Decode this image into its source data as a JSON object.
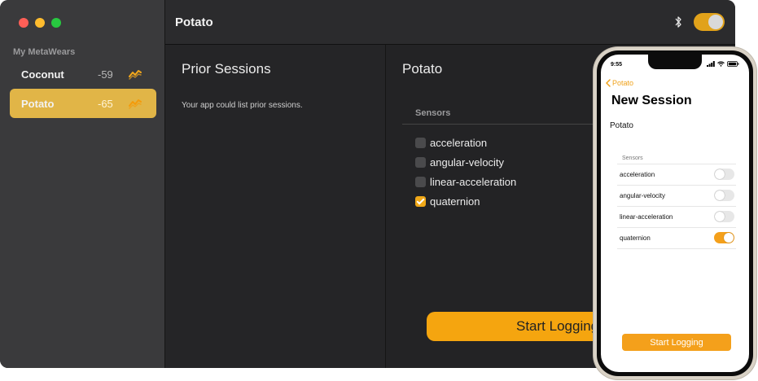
{
  "mac": {
    "sidebar": {
      "section_title": "My MetaWears",
      "devices": [
        {
          "name": "Coconut",
          "rssi": "-59",
          "selected": false
        },
        {
          "name": "Potato",
          "rssi": "-65",
          "selected": true
        }
      ]
    },
    "toolbar": {
      "title": "Potato",
      "bluetooth_enabled": true
    },
    "prior_sessions": {
      "title": "Prior Sessions",
      "description": "Your app could list prior sessions."
    },
    "detail": {
      "title": "Potato",
      "sensors_header": "Sensors",
      "sensors": [
        {
          "name": "acceleration",
          "checked": false
        },
        {
          "name": "angular-velocity",
          "checked": false
        },
        {
          "name": "linear-acceleration",
          "checked": false
        },
        {
          "name": "quaternion",
          "checked": true
        }
      ],
      "start_button": "Start Logging"
    },
    "colors": {
      "accent": "#f5a50f",
      "selected_row": "#e1b547"
    }
  },
  "phone": {
    "status_time": "9:55",
    "back_label": "Potato",
    "title": "New Session",
    "device_name": "Potato",
    "sensors_header": "Sensors",
    "sensors": [
      {
        "name": "acceleration",
        "on": false
      },
      {
        "name": "angular-velocity",
        "on": false
      },
      {
        "name": "linear-acceleration",
        "on": false
      },
      {
        "name": "quaternion",
        "on": true
      }
    ],
    "start_button": "Start Logging"
  }
}
